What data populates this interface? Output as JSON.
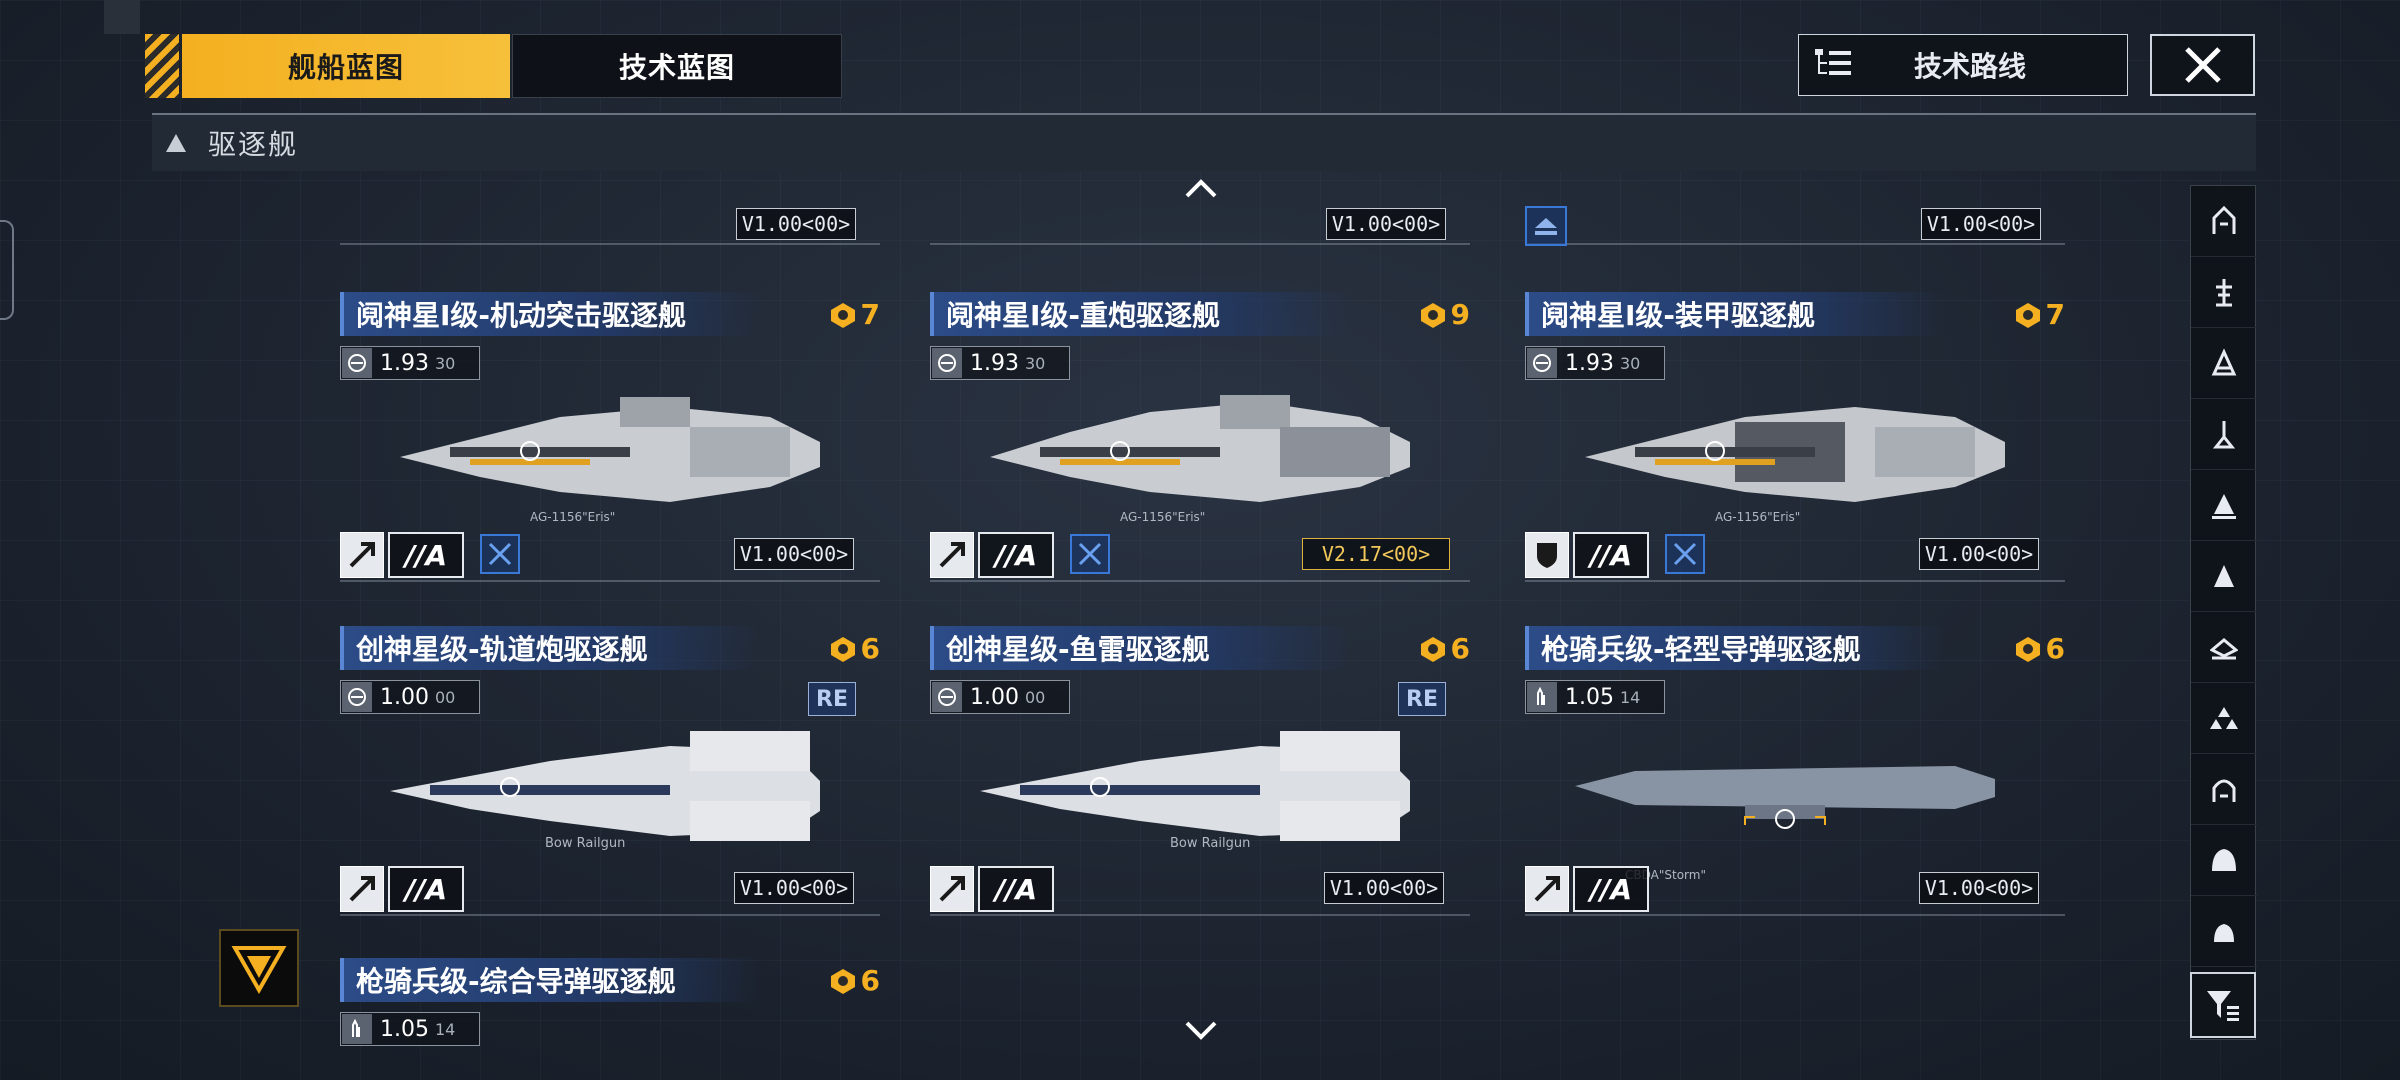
{
  "tabs": {
    "ship_blueprint": "舰船蓝图",
    "tech_blueprint": "技术蓝图",
    "tech_route": "技术路线"
  },
  "category": "驱逐舰",
  "partial_top": [
    {
      "version": "V1.00<00>",
      "icon": "upgrade-icon"
    },
    {
      "version": "V1.00<00>"
    },
    {
      "version": "V1.00<00>"
    }
  ],
  "cards": [
    {
      "title": "阋神星I级-机动突击驱逐舰",
      "cost": "7",
      "stat_main": "1.93",
      "stat_sub": "30",
      "grade": "//A",
      "role_icon": "strike-icon",
      "has_tag": true,
      "version": "V1.00<00>",
      "ship_label": "AG-1156\"Eris\""
    },
    {
      "title": "阋神星I级-重炮驱逐舰",
      "cost": "9",
      "stat_main": "1.93",
      "stat_sub": "30",
      "grade": "//A",
      "role_icon": "strike-icon",
      "has_tag": true,
      "version": "V2.17<00>",
      "ship_label": "AG-1156\"Eris\""
    },
    {
      "title": "阋神星I级-装甲驱逐舰",
      "cost": "7",
      "stat_main": "1.93",
      "stat_sub": "30",
      "grade": "//A",
      "role_icon": "shield-icon",
      "has_tag": true,
      "version": "V1.00<00>",
      "ship_label": "AG-1156\"Eris\""
    },
    {
      "title": "创神星级-轨道炮驱逐舰",
      "cost": "6",
      "stat_main": "1.00",
      "stat_sub": "00",
      "grade": "//A",
      "role_icon": "strike-icon",
      "re": "RE",
      "version": "V1.00<00>",
      "ship_label": "Bow Railgun"
    },
    {
      "title": "创神星级-鱼雷驱逐舰",
      "cost": "6",
      "stat_main": "1.00",
      "stat_sub": "00",
      "grade": "//A",
      "role_icon": "strike-icon",
      "re": "RE",
      "version": "V1.00<00>",
      "ship_label": "Bow Railgun"
    },
    {
      "title": "枪骑兵级-轻型导弹驱逐舰",
      "cost": "6",
      "stat_main": "1.05",
      "stat_sub": "14",
      "grade": "//A",
      "role_icon": "strike-icon",
      "version": "V1.00<00>",
      "ship_label": "CBDA\"Storm\""
    },
    {
      "title": "枪骑兵级-综合导弹驱逐舰",
      "cost": "6",
      "stat_main": "1.05",
      "stat_sub": "14"
    }
  ],
  "colors": {
    "accent": "#f4b020",
    "title_blue": "#2c4c88",
    "tag_blue": "#3a78d8"
  }
}
